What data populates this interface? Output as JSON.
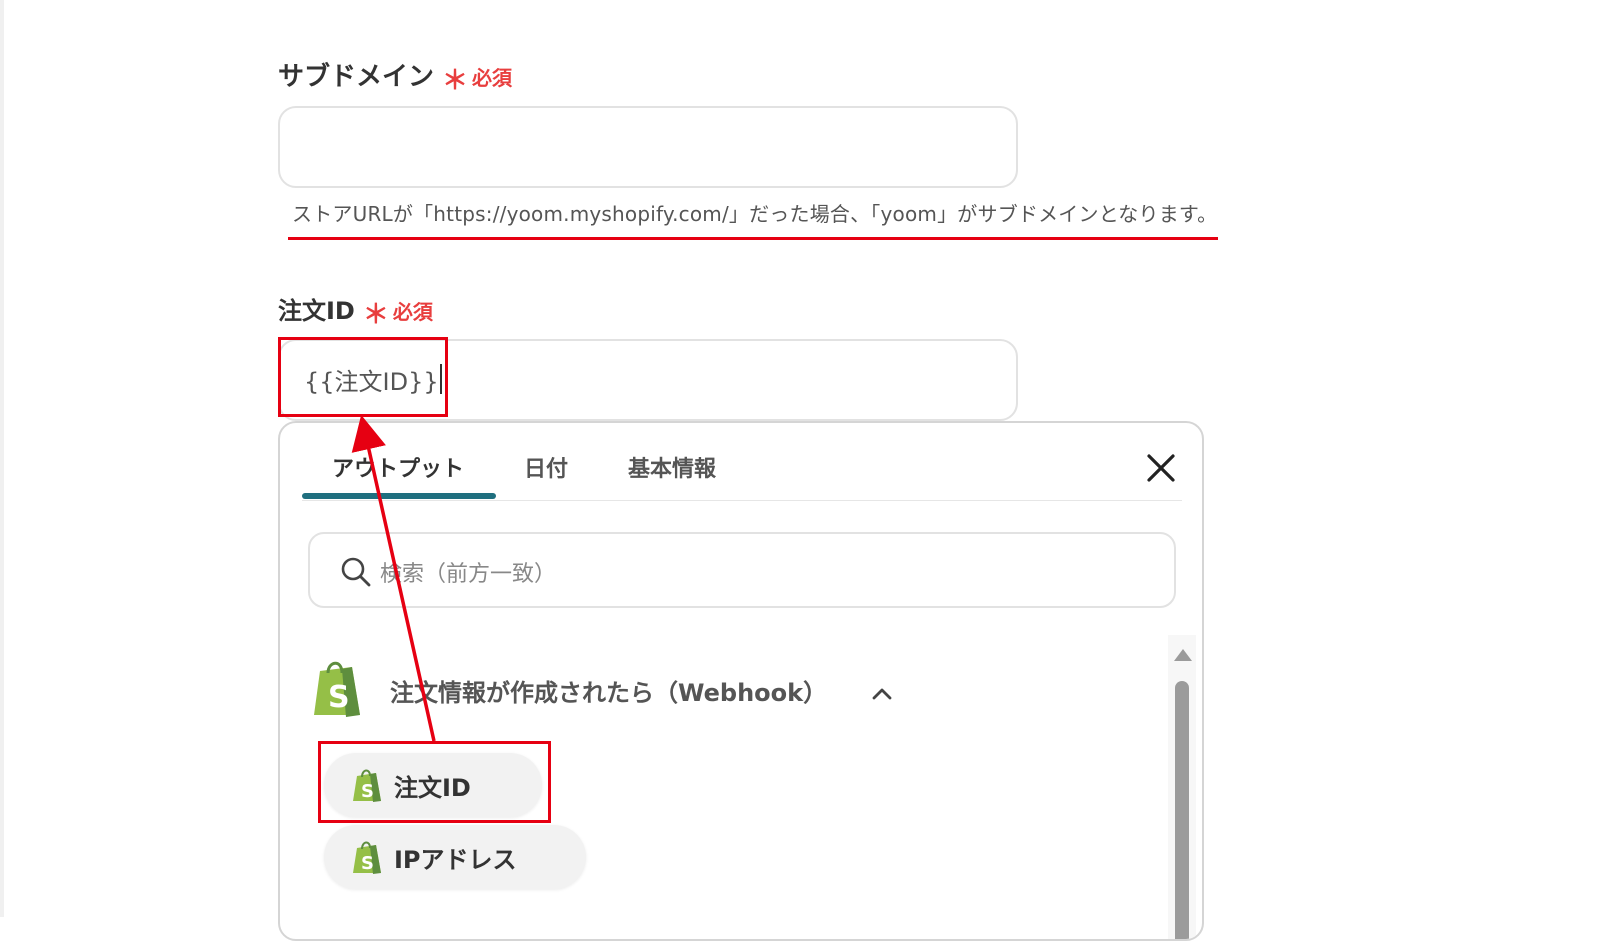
{
  "subdomain": {
    "label": "サブドメイン",
    "required_mark": "＊",
    "required_text": "必須",
    "value": "",
    "help_text": "ストアURLが「https://yoom.myshopify.com/」だった場合、「yoom」がサブドメインとなります。"
  },
  "order_id": {
    "label": "注文ID",
    "required_mark": "＊",
    "required_text": "必須",
    "value": "{{注文ID}}"
  },
  "picker": {
    "tabs": [
      {
        "label": "アウトプット",
        "active": true
      },
      {
        "label": "日付",
        "active": false
      },
      {
        "label": "基本情報",
        "active": false
      }
    ],
    "close_icon": "close-icon",
    "search": {
      "placeholder": "検索（前方一致）",
      "icon": "search-icon"
    },
    "group": {
      "icon": "shopify-icon",
      "title": "注文情報が作成されたら（Webhook）",
      "expanded": true,
      "items": [
        {
          "label": "注文ID",
          "icon": "shopify-icon"
        },
        {
          "label": "IPアドレス",
          "icon": "shopify-icon"
        }
      ]
    }
  },
  "colors": {
    "annotation_red": "#e60012",
    "required_red": "#e83e3e",
    "tab_accent": "#1f6f7f",
    "shopify_green": "#95bf47",
    "shopify_dark": "#5e8e3e"
  }
}
